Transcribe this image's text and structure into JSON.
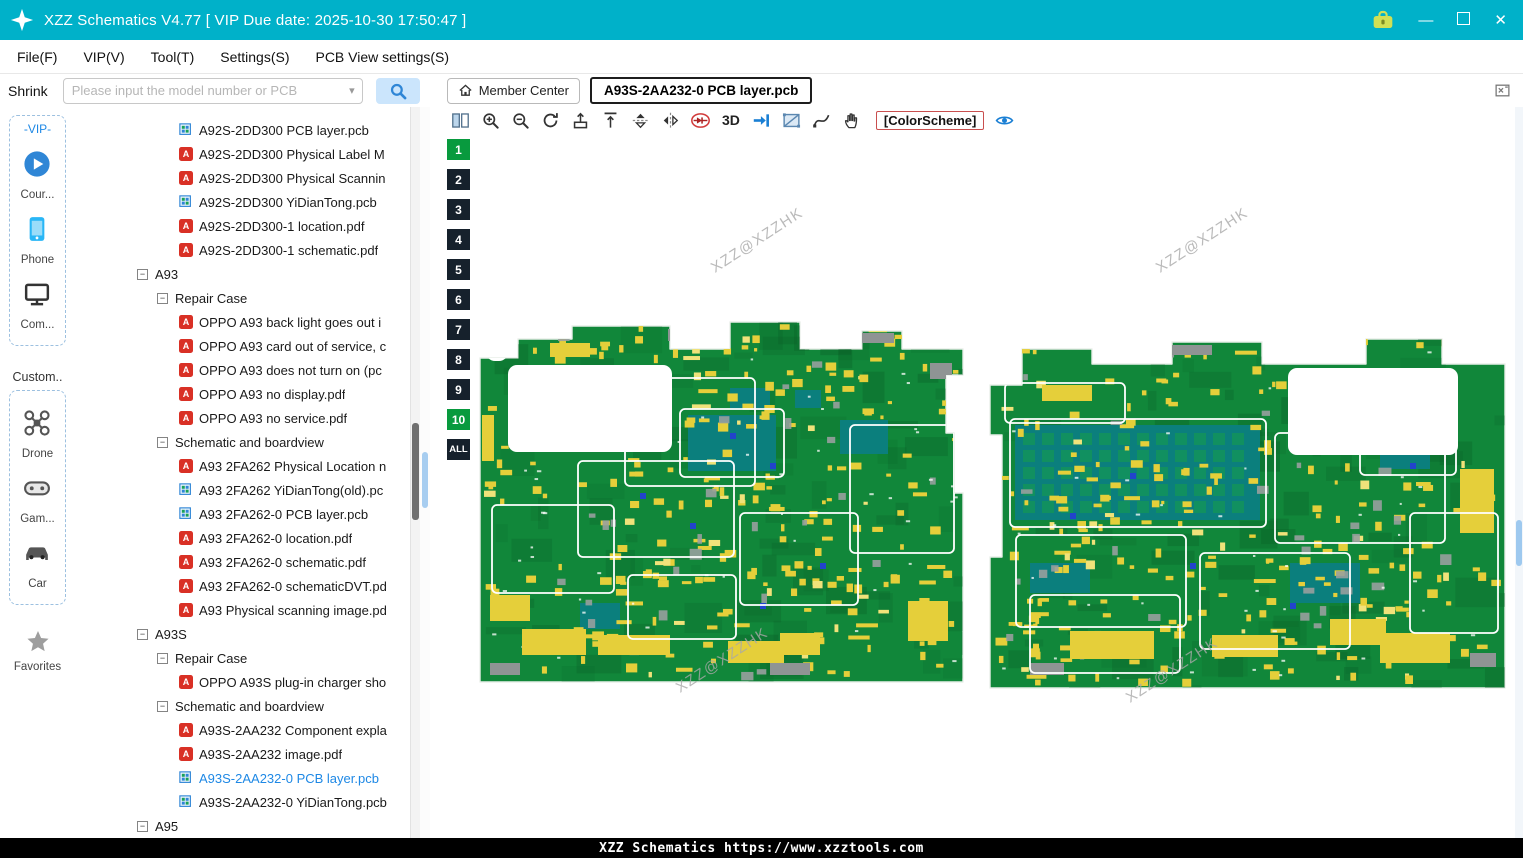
{
  "window": {
    "title": "XZZ Schematics V4.77 [ VIP Due date: 2025-10-30 17:50:47 ]"
  },
  "menu": {
    "items": [
      "File(F)",
      "VIP(V)",
      "Tool(T)",
      "Settings(S)",
      "PCB View settings(S)"
    ]
  },
  "toolbar": {
    "shrink_label": "Shrink",
    "search_placeholder": "Please input the model number or PCB",
    "member_center_label": "Member Center",
    "tab_label": "A93S-2AA232-0 PCB layer.pcb"
  },
  "sidebar": {
    "vip_label": "-VIP-",
    "custom_label": "Custom..",
    "favorites_label": "Favorites",
    "vip_items": [
      {
        "icon": "play",
        "label": "Cour..."
      },
      {
        "icon": "phone",
        "label": "Phone"
      },
      {
        "icon": "computer",
        "label": "Com..."
      }
    ],
    "custom_items": [
      {
        "icon": "drone",
        "label": "Drone"
      },
      {
        "icon": "gamepad",
        "label": "Gam..."
      },
      {
        "icon": "car",
        "label": "Car"
      }
    ]
  },
  "tree": {
    "items": [
      {
        "t": "pcb",
        "lvl": 3,
        "label": "A92S-2DD300 PCB layer.pcb"
      },
      {
        "t": "pdf",
        "lvl": 3,
        "label": "A92S-2DD300 Physical Label M"
      },
      {
        "t": "pdf",
        "lvl": 3,
        "label": "A92S-2DD300 Physical Scannin"
      },
      {
        "t": "pcb",
        "lvl": 3,
        "label": "A92S-2DD300 YiDianTong.pcb"
      },
      {
        "t": "pdf",
        "lvl": 3,
        "label": "A92S-2DD300-1 location.pdf"
      },
      {
        "t": "pdf",
        "lvl": 3,
        "label": "A92S-2DD300-1 schematic.pdf"
      },
      {
        "t": "node",
        "lvl": 1,
        "label": "A93"
      },
      {
        "t": "node",
        "lvl": 2,
        "label": "Repair Case"
      },
      {
        "t": "pdf",
        "lvl": 3,
        "label": "OPPO A93 back light goes out i"
      },
      {
        "t": "pdf",
        "lvl": 3,
        "label": "OPPO A93 card out of service, c"
      },
      {
        "t": "pdf",
        "lvl": 3,
        "label": "OPPO A93 does not turn on (pc"
      },
      {
        "t": "pdf",
        "lvl": 3,
        "label": "OPPO A93 no display.pdf"
      },
      {
        "t": "pdf",
        "lvl": 3,
        "label": "OPPO A93 no service.pdf"
      },
      {
        "t": "node",
        "lvl": 2,
        "label": "Schematic and boardview"
      },
      {
        "t": "pdf",
        "lvl": 3,
        "label": "A93 2FA262 Physical Location n"
      },
      {
        "t": "pcb",
        "lvl": 3,
        "label": "A93 2FA262 YiDianTong(old).pc"
      },
      {
        "t": "pcb",
        "lvl": 3,
        "label": "A93 2FA262-0 PCB layer.pcb"
      },
      {
        "t": "pdf",
        "lvl": 3,
        "label": "A93 2FA262-0 location.pdf"
      },
      {
        "t": "pdf",
        "lvl": 3,
        "label": "A93 2FA262-0 schematic.pdf"
      },
      {
        "t": "pdf",
        "lvl": 3,
        "label": "A93 2FA262-0 schematicDVT.pd"
      },
      {
        "t": "pdf",
        "lvl": 3,
        "label": "A93 Physical scanning image.pd"
      },
      {
        "t": "node",
        "lvl": 1,
        "label": "A93S"
      },
      {
        "t": "node",
        "lvl": 2,
        "label": "Repair Case"
      },
      {
        "t": "pdf",
        "lvl": 3,
        "label": "OPPO A93S plug-in charger sho"
      },
      {
        "t": "node",
        "lvl": 2,
        "label": "Schematic and boardview"
      },
      {
        "t": "pdf",
        "lvl": 3,
        "label": "A93S-2AA232 Component expla"
      },
      {
        "t": "pdf",
        "lvl": 3,
        "label": "A93S-2AA232 image.pdf"
      },
      {
        "t": "pcb",
        "lvl": 3,
        "label": "A93S-2AA232-0 PCB layer.pcb",
        "sel": true
      },
      {
        "t": "pcb",
        "lvl": 3,
        "label": "A93S-2AA232-0 YiDianTong.pcb"
      },
      {
        "t": "node",
        "lvl": 1,
        "label": "A95"
      }
    ]
  },
  "viewer": {
    "toolbar_items": [
      {
        "icon": "split",
        "name": "split-view-icon"
      },
      {
        "icon": "zoom-in",
        "name": "zoom-in-icon"
      },
      {
        "icon": "zoom-out",
        "name": "zoom-out-icon"
      },
      {
        "icon": "refresh",
        "name": "refresh-icon"
      },
      {
        "icon": "export-up",
        "name": "export-up-icon"
      },
      {
        "icon": "export-top",
        "name": "move-to-top-icon"
      },
      {
        "icon": "flip-vertical",
        "name": "flip-vertical-icon"
      },
      {
        "icon": "flip-horizontal",
        "name": "flip-horizontal-icon"
      },
      {
        "icon": "diode",
        "name": "diode-mode-icon"
      },
      {
        "text": "3D",
        "name": "3d-toggle"
      },
      {
        "icon": "goto",
        "name": "goto-layer-icon"
      },
      {
        "icon": "select-area",
        "name": "select-area-icon"
      },
      {
        "icon": "curve",
        "name": "curve-tool-icon"
      },
      {
        "icon": "hand",
        "name": "pan-hand-icon"
      },
      {
        "button": "[ColorScheme]",
        "name": "colorscheme-button"
      },
      {
        "icon": "eye",
        "name": "visibility-eye-icon"
      }
    ],
    "layers": {
      "labels": [
        "1",
        "2",
        "3",
        "4",
        "5",
        "6",
        "7",
        "8",
        "9",
        "10",
        "ALL"
      ],
      "active": [
        "1",
        "10"
      ]
    },
    "watermark": "XZZ@XZZHK"
  },
  "statusbar": {
    "text": "XZZ Schematics https://www.xzztools.com"
  },
  "colors": {
    "titlebar": "#00b1c9",
    "accent": "#1E88E5",
    "layer_active": "#089a3e",
    "layer_inactive": "#16212c",
    "pcb_green": "#11873a",
    "pcb_green_dark": "#0a5c26",
    "pcb_yellow": "#e5cf3a",
    "pcb_yellow_light": "#f0e27a",
    "pcb_teal": "#0b7f7d",
    "pcb_gray": "#98a09e",
    "pcb_blue": "#2244cc",
    "pdf_red": "#d93025",
    "pcb_icon_blue": "#2f86d6"
  }
}
